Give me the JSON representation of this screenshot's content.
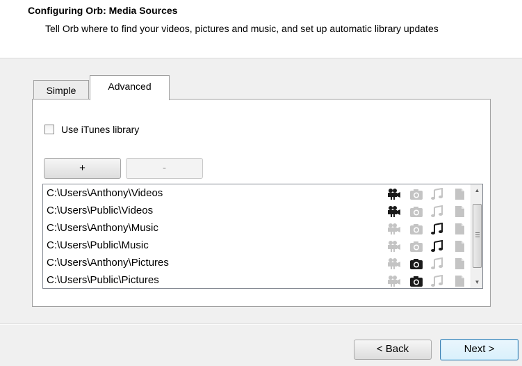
{
  "header": {
    "title": "Configuring Orb: Media Sources",
    "subtitle": "Tell Orb where to find your videos, pictures and music, and set up automatic library updates"
  },
  "tabs": [
    {
      "label": "Simple",
      "selected": false
    },
    {
      "label": "Advanced",
      "selected": true
    }
  ],
  "itunes": {
    "label": "Use iTunes library",
    "checked": false
  },
  "buttons": {
    "add": "+",
    "remove": "-",
    "back": "< Back",
    "next": "Next >"
  },
  "sources": [
    {
      "path": "C:\\Users\\Anthony\\Videos",
      "video": true,
      "photo": false,
      "music": false,
      "document": false
    },
    {
      "path": "C:\\Users\\Public\\Videos",
      "video": true,
      "photo": false,
      "music": false,
      "document": false
    },
    {
      "path": "C:\\Users\\Anthony\\Music",
      "video": false,
      "photo": false,
      "music": true,
      "document": false
    },
    {
      "path": "C:\\Users\\Public\\Music",
      "video": false,
      "photo": false,
      "music": true,
      "document": false
    },
    {
      "path": "C:\\Users\\Anthony\\Pictures",
      "video": false,
      "photo": true,
      "music": false,
      "document": false
    },
    {
      "path": "C:\\Users\\Public\\Pictures",
      "video": false,
      "photo": true,
      "music": false,
      "document": false
    }
  ],
  "colors": {
    "icon_active": "#1a1a1a",
    "icon_inactive": "#c4c4c4",
    "next_border": "#3c7fb1"
  }
}
